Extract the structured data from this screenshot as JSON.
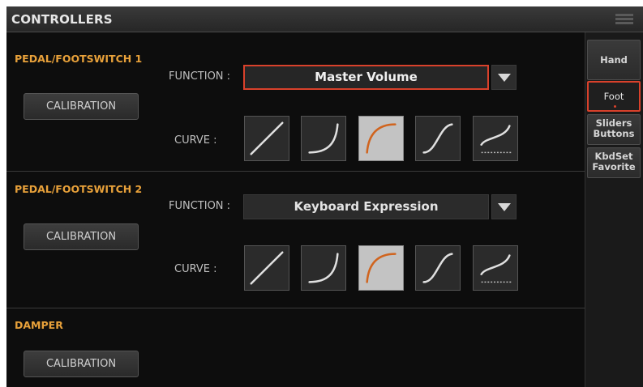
{
  "header": {
    "title": "CONTROLLERS",
    "menu_icon": "menu-icon"
  },
  "sections": [
    {
      "title": "PEDAL/FOOTSWITCH 1",
      "calibration_label": "CALIBRATION",
      "function_label": "FUNCTION :",
      "function_value": "Master Volume",
      "curve_label": "CURVE :",
      "selected_curve": 3
    },
    {
      "title": "PEDAL/FOOTSWITCH 2",
      "calibration_label": "CALIBRATION",
      "function_label": "FUNCTION :",
      "function_value": "Keyboard Expression",
      "curve_label": "CURVE :",
      "selected_curve": 3
    },
    {
      "title": "DAMPER",
      "calibration_label": "CALIBRATION"
    }
  ],
  "curves": [
    "linear-curve-icon",
    "exponential-curve-icon",
    "logarithmic-curve-icon",
    "s-curve-icon",
    "switch-curve-icon"
  ],
  "tabs": [
    {
      "label_line1": "Hand",
      "label_line2": ""
    },
    {
      "label_line1": "Foot",
      "label_line2": ""
    },
    {
      "label_line1": "Sliders",
      "label_line2": "Buttons"
    },
    {
      "label_line1": "KbdSet",
      "label_line2": "Favorite"
    }
  ],
  "active_tab": 1,
  "colors": {
    "accent": "#e8a13a",
    "selection": "#d9412b",
    "curve_orange": "#d0641e"
  }
}
